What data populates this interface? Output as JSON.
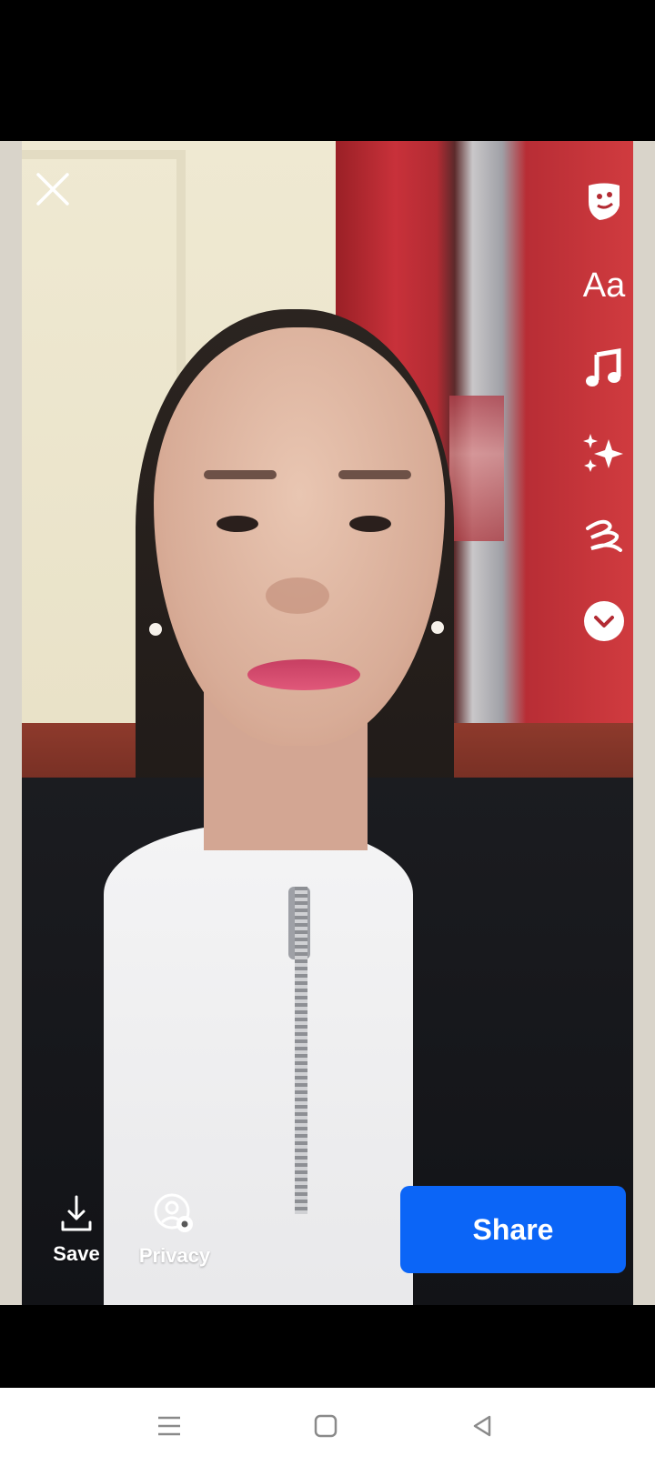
{
  "story_editor": {
    "photo_icon": "portrait-photo",
    "close_icon": "close-icon",
    "tools": [
      {
        "name": "sticker-icon"
      },
      {
        "name": "text-tool",
        "label": "Aa"
      },
      {
        "name": "music-note-icon"
      },
      {
        "name": "effects-sparkle-icon"
      },
      {
        "name": "draw-squiggle-icon"
      },
      {
        "name": "more-chevron-down-icon"
      }
    ],
    "save_label": "Save",
    "privacy_label": "Privacy",
    "share_label": "Share",
    "colors": {
      "share_button": "#0b65f7",
      "overlay_icon": "#ffffff",
      "background": "#000000"
    }
  },
  "system_nav": {
    "icons": [
      "menu-lines-icon",
      "home-square-icon",
      "back-triangle-icon"
    ]
  }
}
